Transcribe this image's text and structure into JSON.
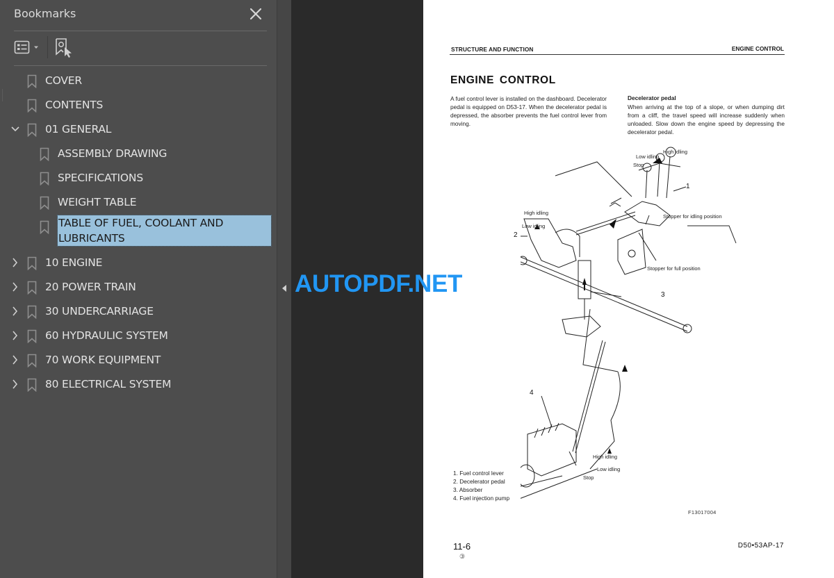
{
  "sidebar": {
    "title": "Bookmarks",
    "icons": {
      "close": "close-icon",
      "options": "bookmark-options-icon",
      "find": "find-current-bookmark-icon"
    },
    "items": [
      {
        "label": "COVER",
        "level": 0,
        "expander": "none"
      },
      {
        "label": "CONTENTS",
        "level": 0,
        "expander": "none"
      },
      {
        "label": "01 GENERAL",
        "level": 0,
        "expander": "expanded"
      },
      {
        "label": "ASSEMBLY DRAWING",
        "level": 1,
        "expander": "none"
      },
      {
        "label": "SPECIFICATIONS",
        "level": 1,
        "expander": "none"
      },
      {
        "label": "WEIGHT TABLE",
        "level": 1,
        "expander": "none"
      },
      {
        "label": "TABLE OF FUEL, COOLANT AND LUBRICANTS",
        "level": 1,
        "expander": "none",
        "selected": true
      },
      {
        "label": "10 ENGINE",
        "level": 0,
        "expander": "collapsed"
      },
      {
        "label": "20 POWER TRAIN",
        "level": 0,
        "expander": "collapsed"
      },
      {
        "label": "30 UNDERCARRIAGE",
        "level": 0,
        "expander": "collapsed"
      },
      {
        "label": "60 HYDRAULIC SYSTEM",
        "level": 0,
        "expander": "collapsed"
      },
      {
        "label": "70 WORK EQUIPMENT",
        "level": 0,
        "expander": "collapsed"
      },
      {
        "label": "80 ELECTRICAL SYSTEM",
        "level": 0,
        "expander": "collapsed"
      }
    ]
  },
  "watermark": "AUTOPDF.NET",
  "page": {
    "header_left": "STRUCTURE AND FUNCTION",
    "header_right": "ENGINE CONTROL",
    "title": "ENGINE  CONTROL",
    "para_left": "A fuel control lever is installed on the dashboard. Decelerator pedal is equipped on D53-17. When the decelerator pedal is depressed, the absorber prevents the fuel control lever from moving.",
    "para_right_title": "Decelerator pedal",
    "para_right": "When arriving at the top of a slope, or when dumping dirt from a cliff, the travel speed will increase suddenly when unloaded.  Slow down the engine speed by depressing the decelerator pedal.",
    "diagram_labels": {
      "high_idling_top": "High idling",
      "low_idling_top": "Low idling",
      "stop_top": "Stop",
      "stopper_idling": "Stopper for idling position",
      "high_idling_pedal": "High idling",
      "low_idling_pedal": "Low idling",
      "stopper_full": "Stopper for full position",
      "high_idling_pump": "High idling",
      "low_idling_pump": "Low idling",
      "stop_pump": "Stop",
      "num1": "1",
      "num2": "2",
      "num3": "3",
      "num4": "4"
    },
    "legend": [
      "1.  Fuel control lever",
      "2.  Decelerator pedal",
      "3.  Absorber",
      "4.  Fuel injection pump"
    ],
    "figure_code": "F13017004",
    "page_number": "11-6",
    "revision": "③",
    "model": "D50•53AP-17"
  }
}
